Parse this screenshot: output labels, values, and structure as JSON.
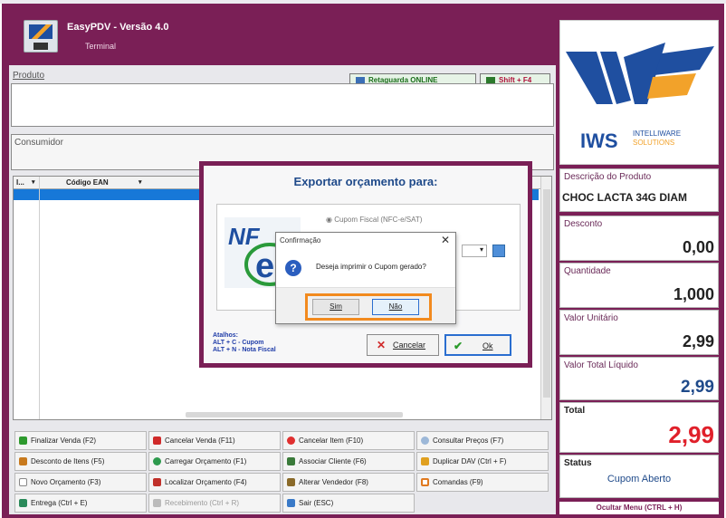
{
  "app": {
    "title": "EasyPDV - Versão 4.0",
    "subtitle": "Terminal"
  },
  "product": {
    "label": "Produto"
  },
  "badges": {
    "retaguarda": "Retaguarda ONLINE",
    "shortcut": "Shift + F4"
  },
  "consumer": {
    "label": "Consumidor"
  },
  "grid": {
    "columns": [
      "I...",
      "Código EAN"
    ]
  },
  "logo": {
    "brand": "IWS",
    "tagline1": "INTELLIWARE",
    "tagline2": "SOLUTIONS"
  },
  "right_panel": {
    "descricao_label": "Descrição do Produto",
    "descricao_value": "CHOC LACTA 34G DIAM",
    "desconto_label": "Desconto",
    "desconto_value": "0,00",
    "quantidade_label": "Quantidade",
    "quantidade_value": "1,000",
    "unit_label": "Valor Unitário",
    "unit_value": "2,99",
    "total_liquido_label": "Valor Total Líquido",
    "total_liquido_value": "2,99",
    "total_label": "Total",
    "total_value": "2,99",
    "status_label": "Status",
    "status_value": "Cupom Aberto",
    "hide_menu": "Ocultar Menu (CTRL + H)"
  },
  "function_buttons": [
    "Finalizar Venda (F2)",
    "Cancelar Venda (F11)",
    "Cancelar Item (F10)",
    "Consultar Preços (F7)",
    "Desconto de Itens (F5)",
    "Carregar Orçamento (F1)",
    "Associar Cliente (F6)",
    "Duplicar DAV (Ctrl + F)",
    "Novo Orçamento (F3)",
    "Localizar Orçamento (F4)",
    "Alterar Vendedor (F8)",
    "Comandas (F9)",
    "Entrega (Ctrl + E)",
    "Recebimento (Ctrl + R)",
    "Sair (ESC)"
  ],
  "export_dialog": {
    "title": "Exportar orçamento para:",
    "option": "Cupom Fiscal (NFC-e/SAT)",
    "atalhos_title": "Atalhos:",
    "atalho1": "ALT + C - Cupom",
    "atalho2": "ALT + N - Nota Fiscal",
    "cancel": "Cancelar",
    "ok": "Ok"
  },
  "confirm_dialog": {
    "title": "Confirmação",
    "close": "✕",
    "message": "Deseja imprimir o Cupom gerado?",
    "yes": "Sim",
    "no": "Não"
  }
}
